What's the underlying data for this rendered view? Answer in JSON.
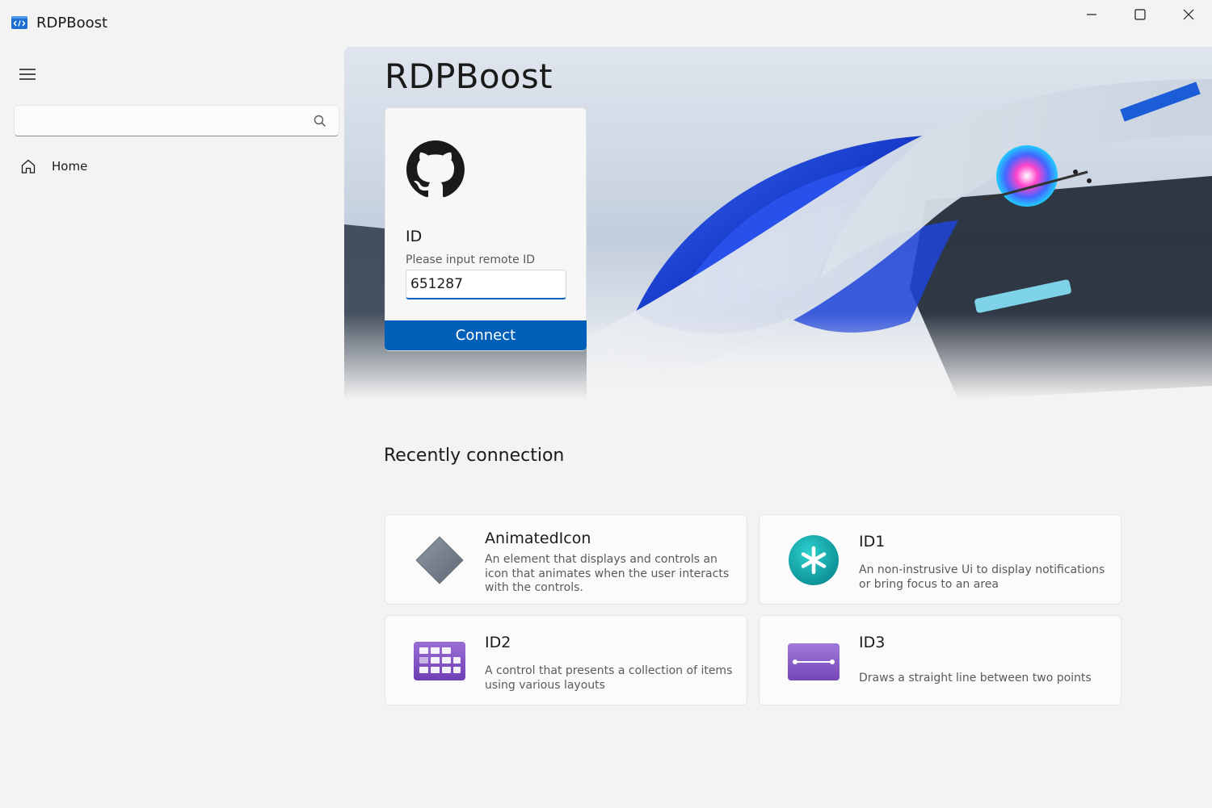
{
  "window": {
    "title": "RDPBoost",
    "caption_buttons": [
      "minimize",
      "maximize",
      "close"
    ]
  },
  "nav": {
    "menu_icon": "hamburger-icon",
    "search": {
      "placeholder": "",
      "value": "",
      "icon": "search-icon"
    },
    "items": [
      {
        "label": "Home",
        "icon": "home-icon"
      }
    ]
  },
  "hero": {
    "title": "RDPBoost",
    "login": {
      "icon": "github-icon",
      "id_label": "ID",
      "id_hint": "Please input remote ID",
      "id_value": "651287",
      "connect_label": "Connect"
    }
  },
  "recent": {
    "title": "Recently connection",
    "items": [
      {
        "title": "AnimatedIcon",
        "description": "An element that displays and controls an icon that animates when the user interacts with the controls.",
        "icon": "diamond-icon"
      },
      {
        "title": "ID1",
        "description": "An non-instrusive Ui to display notifications or bring focus to an area",
        "icon": "asterisk-icon"
      },
      {
        "title": "ID2",
        "description": "A control that presents a collection of items using various layouts",
        "icon": "grid-icon"
      },
      {
        "title": "ID3",
        "description": "Draws a straight line between two points",
        "icon": "line-icon"
      }
    ]
  },
  "colors": {
    "accent": "#005fb8",
    "background": "#f3f3f3",
    "card": "#fbfbfb"
  }
}
